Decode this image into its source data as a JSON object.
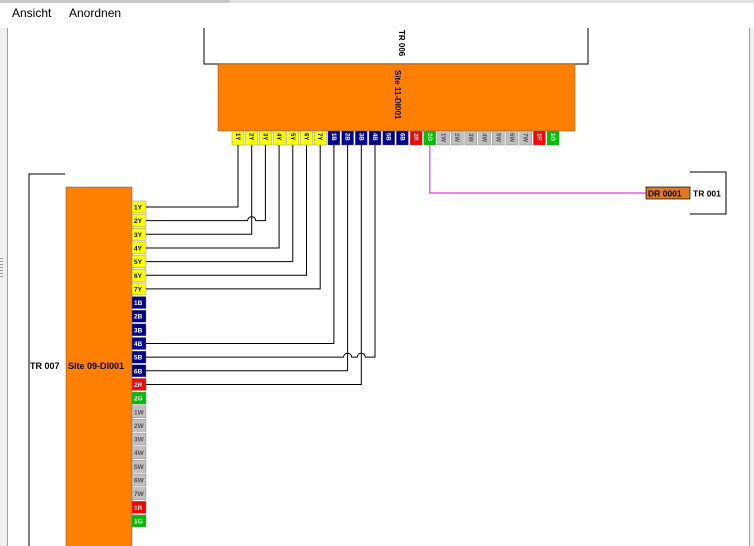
{
  "menu": {
    "items": [
      {
        "label": "Ansicht"
      },
      {
        "label": "Anordnen"
      }
    ]
  },
  "diagram": {
    "top_enclosure_label": "TR 006",
    "top_site_label": "Site 11-DI001",
    "left_enclosure_label": "TR 007",
    "left_site_label": "Site 09-DI001",
    "right_enclosure_label": "TR 001",
    "right_device_label": "DR 0001",
    "top_ports": [
      "1Y",
      "2Y",
      "3Y",
      "4Y",
      "5Y",
      "6Y",
      "7Y",
      "1B",
      "2B",
      "3B",
      "4B",
      "5B",
      "6B",
      "2R",
      "2G",
      "1W",
      "2W",
      "3W",
      "4W",
      "5W",
      "6W",
      "7W",
      "1R",
      "1G"
    ],
    "left_ports": [
      "1Y",
      "2Y",
      "3Y",
      "4Y",
      "5Y",
      "6Y",
      "7Y",
      "1B",
      "2B",
      "3B",
      "4B",
      "5B",
      "6B",
      "2R",
      "2G",
      "1W",
      "2W",
      "3W",
      "4W",
      "5W",
      "6W",
      "7W",
      "1R",
      "1G"
    ],
    "connections": [
      {
        "from": "1Y",
        "to": "1Y"
      },
      {
        "from": "2Y",
        "to": "3Y"
      },
      {
        "from": "3Y",
        "to": "2Y"
      },
      {
        "from": "4Y",
        "to": "4Y"
      },
      {
        "from": "5Y",
        "to": "5Y"
      },
      {
        "from": "6Y",
        "to": "6Y"
      },
      {
        "from": "7Y",
        "to": "7Y"
      },
      {
        "from": "1B",
        "to": "4B"
      },
      {
        "from": "2B",
        "to": "6B"
      },
      {
        "from": "3B",
        "to": "2R"
      },
      {
        "from": "4B",
        "to": "5B"
      }
    ],
    "magenta_connection": {
      "from": "2G",
      "to": "DR 0001"
    },
    "colors": {
      "site_fill": "#ff8000",
      "yellow": "#ffff00",
      "blue": "#00008b",
      "red": "#ff0000",
      "green": "#00c000",
      "white_port": "#c0c0c0",
      "magenta": "#e040e0",
      "wire": "#000000"
    }
  }
}
